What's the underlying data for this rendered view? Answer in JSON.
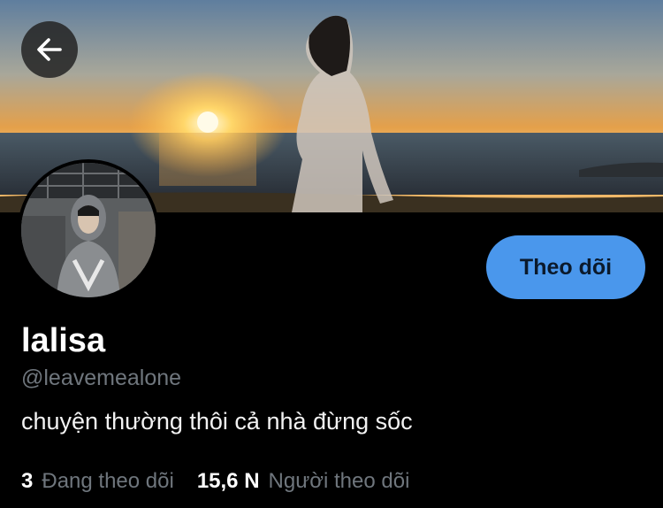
{
  "profile": {
    "display_name": "lalisa",
    "handle": "@leavemealone",
    "bio": "chuyện thường thôi cả nhà đừng sốc"
  },
  "actions": {
    "follow_label": "Theo dõi",
    "back_icon": "arrow-left-icon"
  },
  "stats": {
    "following_count": "3",
    "following_label": "Đang theo dõi",
    "followers_count": "15,6 N",
    "followers_label": "Người theo dõi"
  },
  "colors": {
    "background": "#000000",
    "accent": "#4a97ec",
    "muted_text": "#6f767d"
  }
}
